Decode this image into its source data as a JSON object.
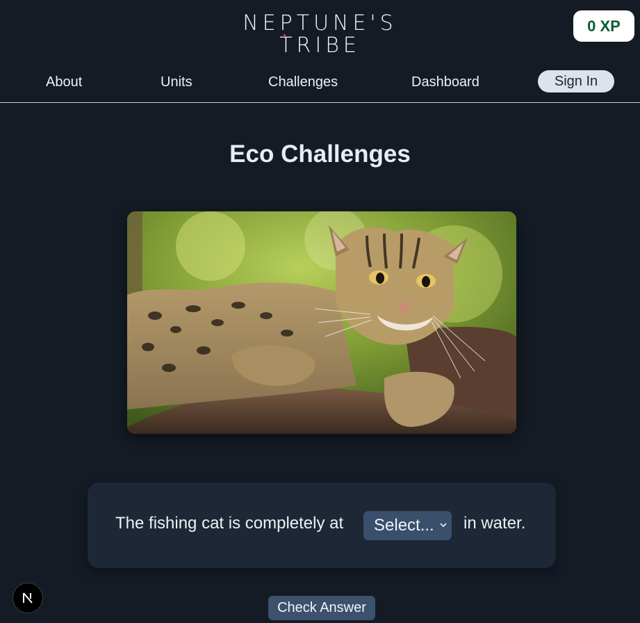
{
  "header": {
    "logo_line1": "NEPTUNE'S",
    "logo_line2": "TRIBE",
    "xp_label": "0 XP"
  },
  "nav": {
    "items": [
      "About",
      "Units",
      "Challenges",
      "Dashboard"
    ],
    "sign_in_label": "Sign In"
  },
  "main": {
    "title": "Eco Challenges",
    "image_icon": "fishing-cat-photo",
    "question": {
      "prefix": "The fishing cat is completely at",
      "select_value": "Select...",
      "suffix": "in water."
    },
    "check_label": "Check Answer"
  },
  "overlay": {
    "dev_badge_glyph": "N",
    "dev_badge_icon": "nextjs-icon"
  },
  "colors": {
    "background": "#141b25",
    "card": "#1d2736",
    "button": "#3b516c",
    "xp_text": "#0e5c32",
    "accent_dot": "#e0463e"
  }
}
